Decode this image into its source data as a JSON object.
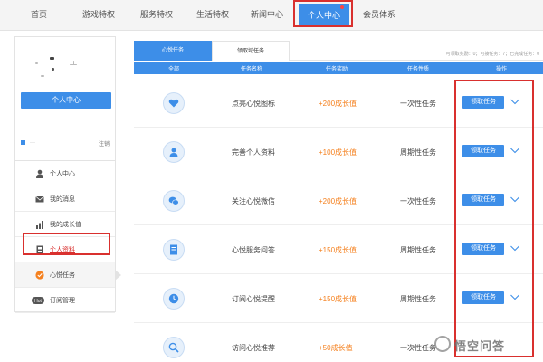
{
  "nav": {
    "items": [
      "首页",
      "游戏特权",
      "服务特权",
      "生活特权",
      "新闻中心",
      "个人中心",
      "会员体系"
    ],
    "active_index": 5
  },
  "sidebar": {
    "center_button": "个人中心",
    "user_name_hint": "···",
    "logout": "注销",
    "menu": [
      {
        "label": "个人中心",
        "icon": "user-icon"
      },
      {
        "label": "我的消息",
        "icon": "mail-icon"
      },
      {
        "label": "我的成长值",
        "icon": "bar-chart-icon"
      },
      {
        "label": "个人资料",
        "icon": "id-card-icon"
      },
      {
        "label": "心悦任务",
        "icon": "task-badge-icon"
      },
      {
        "label": "订阅管理",
        "icon": "hot-badge-icon"
      }
    ],
    "active_index": 4
  },
  "tabs": [
    "心悦任务",
    "领取域任务"
  ],
  "tab_info": "可领取奖励：0；可接任务：7；已完成任务：0",
  "table": {
    "headers": [
      "全部",
      "任务名称",
      "任务奖励",
      "任务性质",
      "操作"
    ],
    "rows": [
      {
        "icon": "heart-icon",
        "name": "点亮心悦图标",
        "reward": "+200成长值",
        "type": "一次性任务",
        "action": "领取任务"
      },
      {
        "icon": "profile-icon",
        "name": "完善个人资料",
        "reward": "+100成长值",
        "type": "周期性任务",
        "action": "领取任务"
      },
      {
        "icon": "wechat-icon",
        "name": "关注心悦微信",
        "reward": "+200成长值",
        "type": "一次性任务",
        "action": "领取任务"
      },
      {
        "icon": "document-icon",
        "name": "心悦服务问答",
        "reward": "+150成长值",
        "type": "周期性任务",
        "action": "领取任务"
      },
      {
        "icon": "clock-icon",
        "name": "订阅心悦提醒",
        "reward": "+150成长值",
        "type": "周期性任务",
        "action": "领取任务"
      },
      {
        "icon": "search-icon",
        "name": "访问心悦推荐",
        "reward": "+50成长值",
        "type": "一次性任务",
        "action": "领取任务"
      }
    ]
  },
  "watermark": "悟空问答",
  "colors": {
    "primary": "#3d8ee8",
    "reward": "#f5811f",
    "highlight": "#d9302e"
  }
}
